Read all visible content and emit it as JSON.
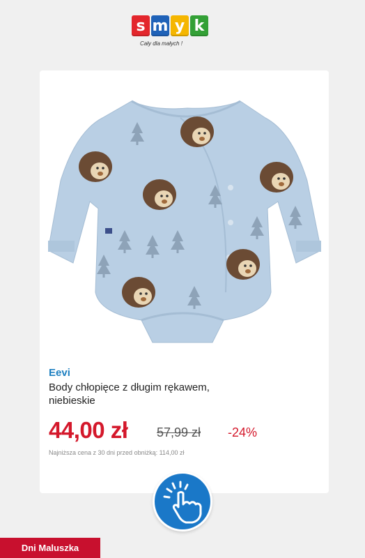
{
  "logo": {
    "letters": [
      "s",
      "m",
      "y",
      "k"
    ],
    "tile_colors": [
      "#e3262c",
      "#1f62b8",
      "#f5b600",
      "#33a036"
    ],
    "tagline": "Cały dla małych !"
  },
  "product": {
    "image_icon": "baby-bodysuit-hedgehog-image",
    "brand": "Eevi",
    "title": "Body chłopięce z długim rękawem, niebieskie",
    "price": "44,00 zł",
    "old_price": "57,99 zł",
    "discount": "-24%",
    "lowest_price_note": "Najniższa cena z 30 dni przed obniżką: 114,00 zł"
  },
  "cta": {
    "icon": "tap-hand-icon",
    "color": "#1a78c8"
  },
  "badge": {
    "label": "Dni Maluszka",
    "color": "#c8102e"
  },
  "colors": {
    "price": "#d4182b",
    "brand": "#1d7fc0"
  }
}
